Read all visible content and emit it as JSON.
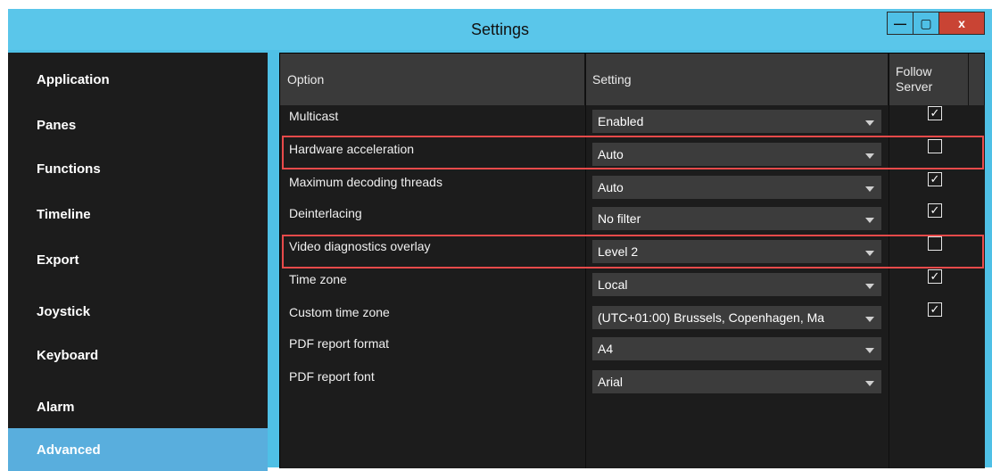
{
  "window": {
    "title": "Settings",
    "minimize_glyph": "—",
    "maximize_glyph": "▢",
    "close_glyph": "x"
  },
  "sidebar": {
    "items": [
      {
        "label": "Application"
      },
      {
        "label": "Panes"
      },
      {
        "label": "Functions"
      },
      {
        "label": "Timeline"
      },
      {
        "label": "Export"
      },
      {
        "label": "Joystick"
      },
      {
        "label": "Keyboard"
      },
      {
        "label": "Alarm"
      },
      {
        "label": "Advanced",
        "active": true
      }
    ]
  },
  "table": {
    "headers": {
      "option": "Option",
      "setting": "Setting",
      "follow_line1": "Follow",
      "follow_line2": "Server"
    },
    "rows": [
      {
        "option": "Multicast",
        "setting": "Enabled",
        "follow_server": true,
        "highlighted": false
      },
      {
        "option": "Hardware acceleration",
        "setting": "Auto",
        "follow_server": false,
        "highlighted": true
      },
      {
        "option": "Maximum decoding threads",
        "setting": "Auto",
        "follow_server": true,
        "highlighted": false
      },
      {
        "option": "Deinterlacing",
        "setting": "No filter",
        "follow_server": true,
        "highlighted": false
      },
      {
        "option": "Video diagnostics overlay",
        "setting": "Level 2",
        "follow_server": false,
        "highlighted": true
      },
      {
        "option": "Time zone",
        "setting": "Local",
        "follow_server": true,
        "highlighted": false
      },
      {
        "option": "Custom time zone",
        "setting": "(UTC+01:00) Brussels, Copenhagen, Ma",
        "follow_server": true,
        "highlighted": false
      },
      {
        "option": "PDF report format",
        "setting": "A4",
        "follow_server": null,
        "highlighted": false
      },
      {
        "option": "PDF report font",
        "setting": "Arial",
        "follow_server": null,
        "highlighted": false
      }
    ]
  },
  "colors": {
    "titlebar": "#5ac6ea",
    "panel": "#1c1c1c",
    "active_nav": "#59aedd",
    "highlight_border": "#e84a4a"
  }
}
